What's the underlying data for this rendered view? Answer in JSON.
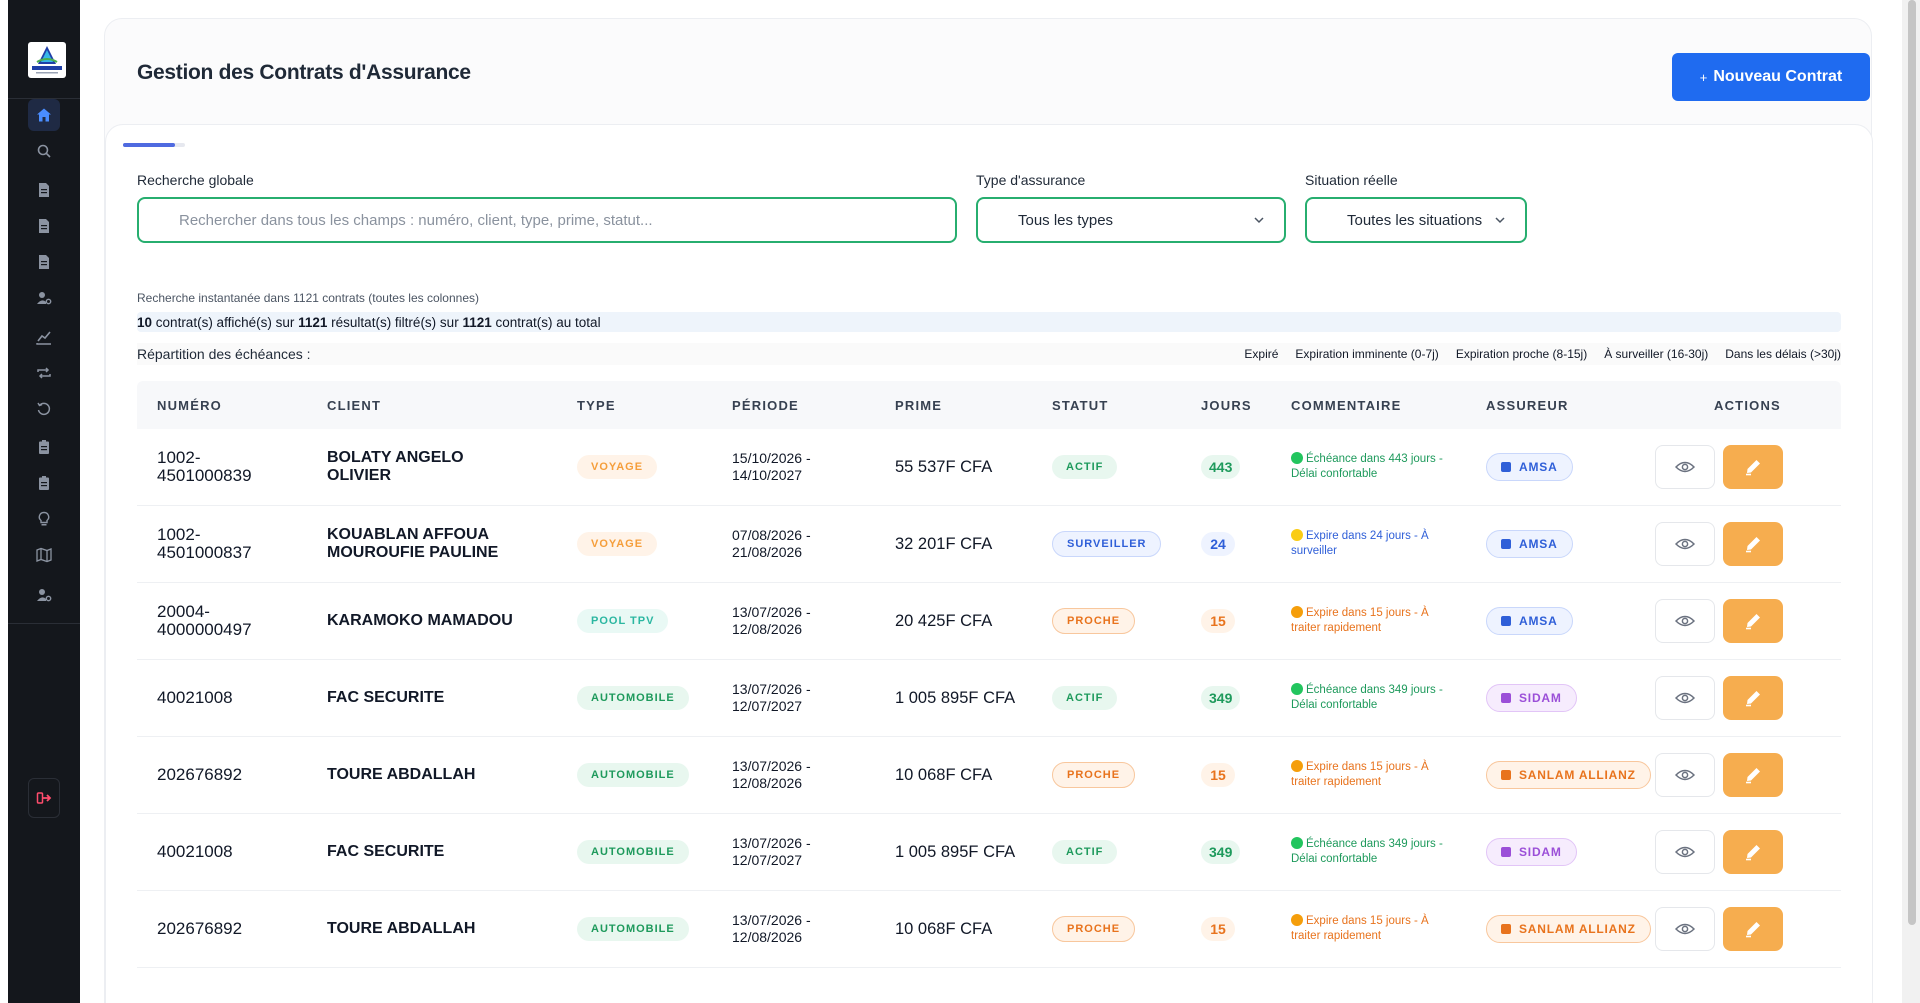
{
  "header": {
    "title": "Gestion des Contrats d'Assurance",
    "new_contract_plus": "+",
    "new_contract_label": "Nouveau Contrat"
  },
  "logo": {
    "text": "ASSURANCE"
  },
  "filters": {
    "search_label": "Recherche globale",
    "search_placeholder": "Rechercher dans tous les champs : numéro, client, type, prime, statut...",
    "search_hint": "Recherche instantanée dans 1121 contrats (toutes les colonnes)",
    "type_label": "Type d'assurance",
    "type_value": "Tous les types",
    "situation_label": "Situation réelle",
    "situation_value": "Toutes les situations"
  },
  "stats": {
    "displayed": "10",
    "displayed_text": "contrat(s) affiché(s) sur",
    "filtered": "1121",
    "filtered_text": "résultat(s) filtré(s) sur",
    "total": "1121",
    "total_text": "contrat(s) au total"
  },
  "repartition": {
    "label": "Répartition des échéances :",
    "legend": [
      "Expiré",
      "Expiration imminente (0-7j)",
      "Expiration proche (8-15j)",
      "À surveiller (16-30j)",
      "Dans les délais (>30j)"
    ]
  },
  "table": {
    "headers": [
      "NUMÉRO",
      "CLIENT",
      "TYPE",
      "PÉRIODE",
      "PRIME",
      "STATUT",
      "JOURS",
      "COMMENTAIRE",
      "ASSUREUR",
      "ACTIONS"
    ],
    "rows": [
      {
        "numero": "1002-\n4501000839",
        "client": "BOLATY ANGELO OLIVIER",
        "type": "VOYAGE",
        "periode": "15/10/2026 -\n14/10/2027",
        "prime": "55 537F CFA",
        "statut": "ACTIF",
        "jours": "443",
        "commentaire": "Échéance dans 443 jours - Délai confortable",
        "assureur": "AMSA"
      },
      {
        "numero": "1002-\n4501000837",
        "client": "KOUABLAN AFFOUA MOUROUFIE PAULINE",
        "type": "VOYAGE",
        "periode": "07/08/2026 -\n21/08/2026",
        "prime": "32 201F CFA",
        "statut": "SURVEILLER",
        "jours": "24",
        "commentaire": "Expire dans 24 jours - À surveiller",
        "assureur": "AMSA"
      },
      {
        "numero": "20004-\n4000000497",
        "client": "KARAMOKO MAMADOU",
        "type": "POOL TPV",
        "periode": "13/07/2026 -\n12/08/2026",
        "prime": "20 425F CFA",
        "statut": "PROCHE",
        "jours": "15",
        "commentaire": "Expire dans 15 jours - À traiter rapidement",
        "assureur": "AMSA"
      },
      {
        "numero": "40021008",
        "client": "FAC SECURITE",
        "type": "AUTOMOBILE",
        "periode": "13/07/2026 -\n12/07/2027",
        "prime": "1 005 895F CFA",
        "statut": "ACTIF",
        "jours": "349",
        "commentaire": "Échéance dans 349 jours - Délai confortable",
        "assureur": "SIDAM"
      },
      {
        "numero": "202676892",
        "client": "TOURE ABDALLAH",
        "type": "AUTOMOBILE",
        "periode": "13/07/2026 -\n12/08/2026",
        "prime": "10 068F CFA",
        "statut": "PROCHE",
        "jours": "15",
        "commentaire": "Expire dans 15 jours - À traiter rapidement",
        "assureur": "SANLAM ALLIANZ"
      },
      {
        "numero": "40021008",
        "client": "FAC SECURITE",
        "type": "AUTOMOBILE",
        "periode": "13/07/2026 -\n12/07/2027",
        "prime": "1 005 895F CFA",
        "statut": "ACTIF",
        "jours": "349",
        "commentaire": "Échéance dans 349 jours - Délai confortable",
        "assureur": "SIDAM"
      },
      {
        "numero": "202676892",
        "client": "TOURE ABDALLAH",
        "type": "AUTOMOBILE",
        "periode": "13/07/2026 -\n12/08/2026",
        "prime": "10 068F CFA",
        "statut": "PROCHE",
        "jours": "15",
        "commentaire": "Expire dans 15 jours - À traiter rapidement",
        "assureur": "SANLAM ALLIANZ"
      }
    ]
  },
  "sidebar": {
    "icons": [
      "home-icon",
      "search-icon",
      "document-icon",
      "document-icon",
      "document-icon",
      "user-gear-icon",
      "chart-line-icon",
      "repeat-icon",
      "history-icon",
      "clipboard-icon",
      "clipboard-icon",
      "lightbulb-icon",
      "map-icon",
      "user-gear-icon",
      "logout-icon"
    ]
  },
  "colors": {
    "primary": "#1f6bf0",
    "sidebar_bg": "#14171c",
    "input_border": "#27ae6f",
    "edit_button": "#f6ad4f"
  }
}
